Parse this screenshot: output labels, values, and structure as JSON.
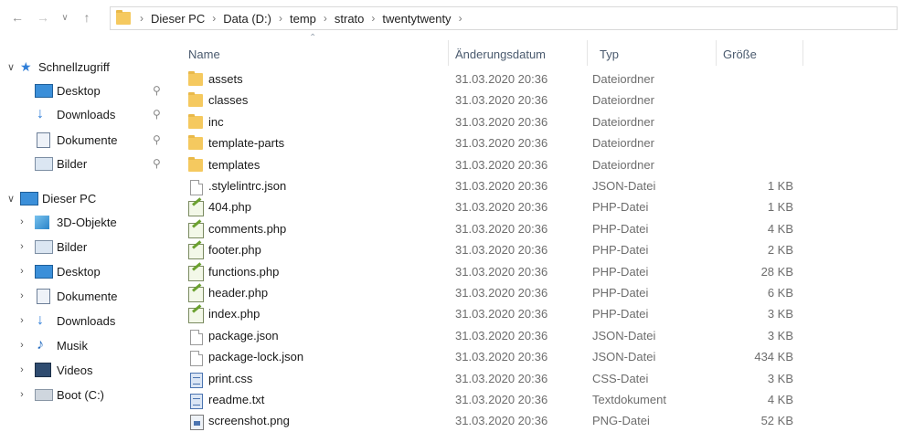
{
  "address_bar": {
    "path": [
      "Dieser PC",
      "Data (D:)",
      "temp",
      "strato",
      "twentytwenty"
    ]
  },
  "sidebar": {
    "quick_access": {
      "label": "Schnellzugriff",
      "items": [
        {
          "label": "Desktop",
          "icon": "desktop-icon"
        },
        {
          "label": "Downloads",
          "icon": "download-icon"
        },
        {
          "label": "Dokumente",
          "icon": "documents-icon"
        },
        {
          "label": "Bilder",
          "icon": "pictures-icon"
        }
      ]
    },
    "this_pc": {
      "label": "Dieser PC",
      "items": [
        {
          "label": "3D-Objekte",
          "icon": "3d-objects-icon"
        },
        {
          "label": "Bilder",
          "icon": "pictures-icon"
        },
        {
          "label": "Desktop",
          "icon": "desktop-icon"
        },
        {
          "label": "Dokumente",
          "icon": "documents-icon"
        },
        {
          "label": "Downloads",
          "icon": "download-icon"
        },
        {
          "label": "Musik",
          "icon": "music-icon"
        },
        {
          "label": "Videos",
          "icon": "videos-icon"
        },
        {
          "label": "Boot (C:)",
          "icon": "drive-icon"
        }
      ]
    }
  },
  "columns": {
    "name": "Name",
    "date": "Änderungsdatum",
    "type": "Typ",
    "size": "Größe"
  },
  "files": [
    {
      "name": "assets",
      "date": "31.03.2020 20:36",
      "type": "Dateiordner",
      "size": "",
      "icon": "folder"
    },
    {
      "name": "classes",
      "date": "31.03.2020 20:36",
      "type": "Dateiordner",
      "size": "",
      "icon": "folder"
    },
    {
      "name": "inc",
      "date": "31.03.2020 20:36",
      "type": "Dateiordner",
      "size": "",
      "icon": "folder"
    },
    {
      "name": "template-parts",
      "date": "31.03.2020 20:36",
      "type": "Dateiordner",
      "size": "",
      "icon": "folder"
    },
    {
      "name": "templates",
      "date": "31.03.2020 20:36",
      "type": "Dateiordner",
      "size": "",
      "icon": "folder"
    },
    {
      "name": ".stylelintrc.json",
      "date": "31.03.2020 20:36",
      "type": "JSON-Datei",
      "size": "1 KB",
      "icon": "doc"
    },
    {
      "name": "404.php",
      "date": "31.03.2020 20:36",
      "type": "PHP-Datei",
      "size": "1 KB",
      "icon": "php"
    },
    {
      "name": "comments.php",
      "date": "31.03.2020 20:36",
      "type": "PHP-Datei",
      "size": "4 KB",
      "icon": "php"
    },
    {
      "name": "footer.php",
      "date": "31.03.2020 20:36",
      "type": "PHP-Datei",
      "size": "2 KB",
      "icon": "php"
    },
    {
      "name": "functions.php",
      "date": "31.03.2020 20:36",
      "type": "PHP-Datei",
      "size": "28 KB",
      "icon": "php"
    },
    {
      "name": "header.php",
      "date": "31.03.2020 20:36",
      "type": "PHP-Datei",
      "size": "6 KB",
      "icon": "php"
    },
    {
      "name": "index.php",
      "date": "31.03.2020 20:36",
      "type": "PHP-Datei",
      "size": "3 KB",
      "icon": "php"
    },
    {
      "name": "package.json",
      "date": "31.03.2020 20:36",
      "type": "JSON-Datei",
      "size": "3 KB",
      "icon": "doc"
    },
    {
      "name": "package-lock.json",
      "date": "31.03.2020 20:36",
      "type": "JSON-Datei",
      "size": "434 KB",
      "icon": "doc"
    },
    {
      "name": "print.css",
      "date": "31.03.2020 20:36",
      "type": "CSS-Datei",
      "size": "3 KB",
      "icon": "txt"
    },
    {
      "name": "readme.txt",
      "date": "31.03.2020 20:36",
      "type": "Textdokument",
      "size": "4 KB",
      "icon": "txt"
    },
    {
      "name": "screenshot.png",
      "date": "31.03.2020 20:36",
      "type": "PNG-Datei",
      "size": "52 KB",
      "icon": "img"
    }
  ]
}
